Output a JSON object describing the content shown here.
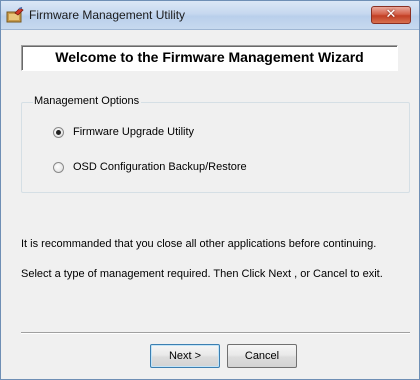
{
  "window": {
    "title": "Firmware Management Utility",
    "close_symbol": "✕",
    "icon": "app-icon"
  },
  "header": {
    "title": "Welcome to the Firmware Management Wizard"
  },
  "options": {
    "group_label": "Management Options",
    "items": [
      {
        "label": "Firmware Upgrade Utility",
        "selected": true
      },
      {
        "label": "OSD Configuration Backup/Restore",
        "selected": false
      }
    ]
  },
  "info": {
    "line1": "It is recommanded that you close all other applications before continuing.",
    "line2": "Select a type of management required. Then Click Next , or Cancel to exit."
  },
  "buttons": {
    "next_label": "Next >",
    "cancel_label": "Cancel"
  },
  "colors": {
    "window_bg": "#f0f0f0",
    "close_button": "#c94a32",
    "title_bar": "#c6d8ef"
  }
}
